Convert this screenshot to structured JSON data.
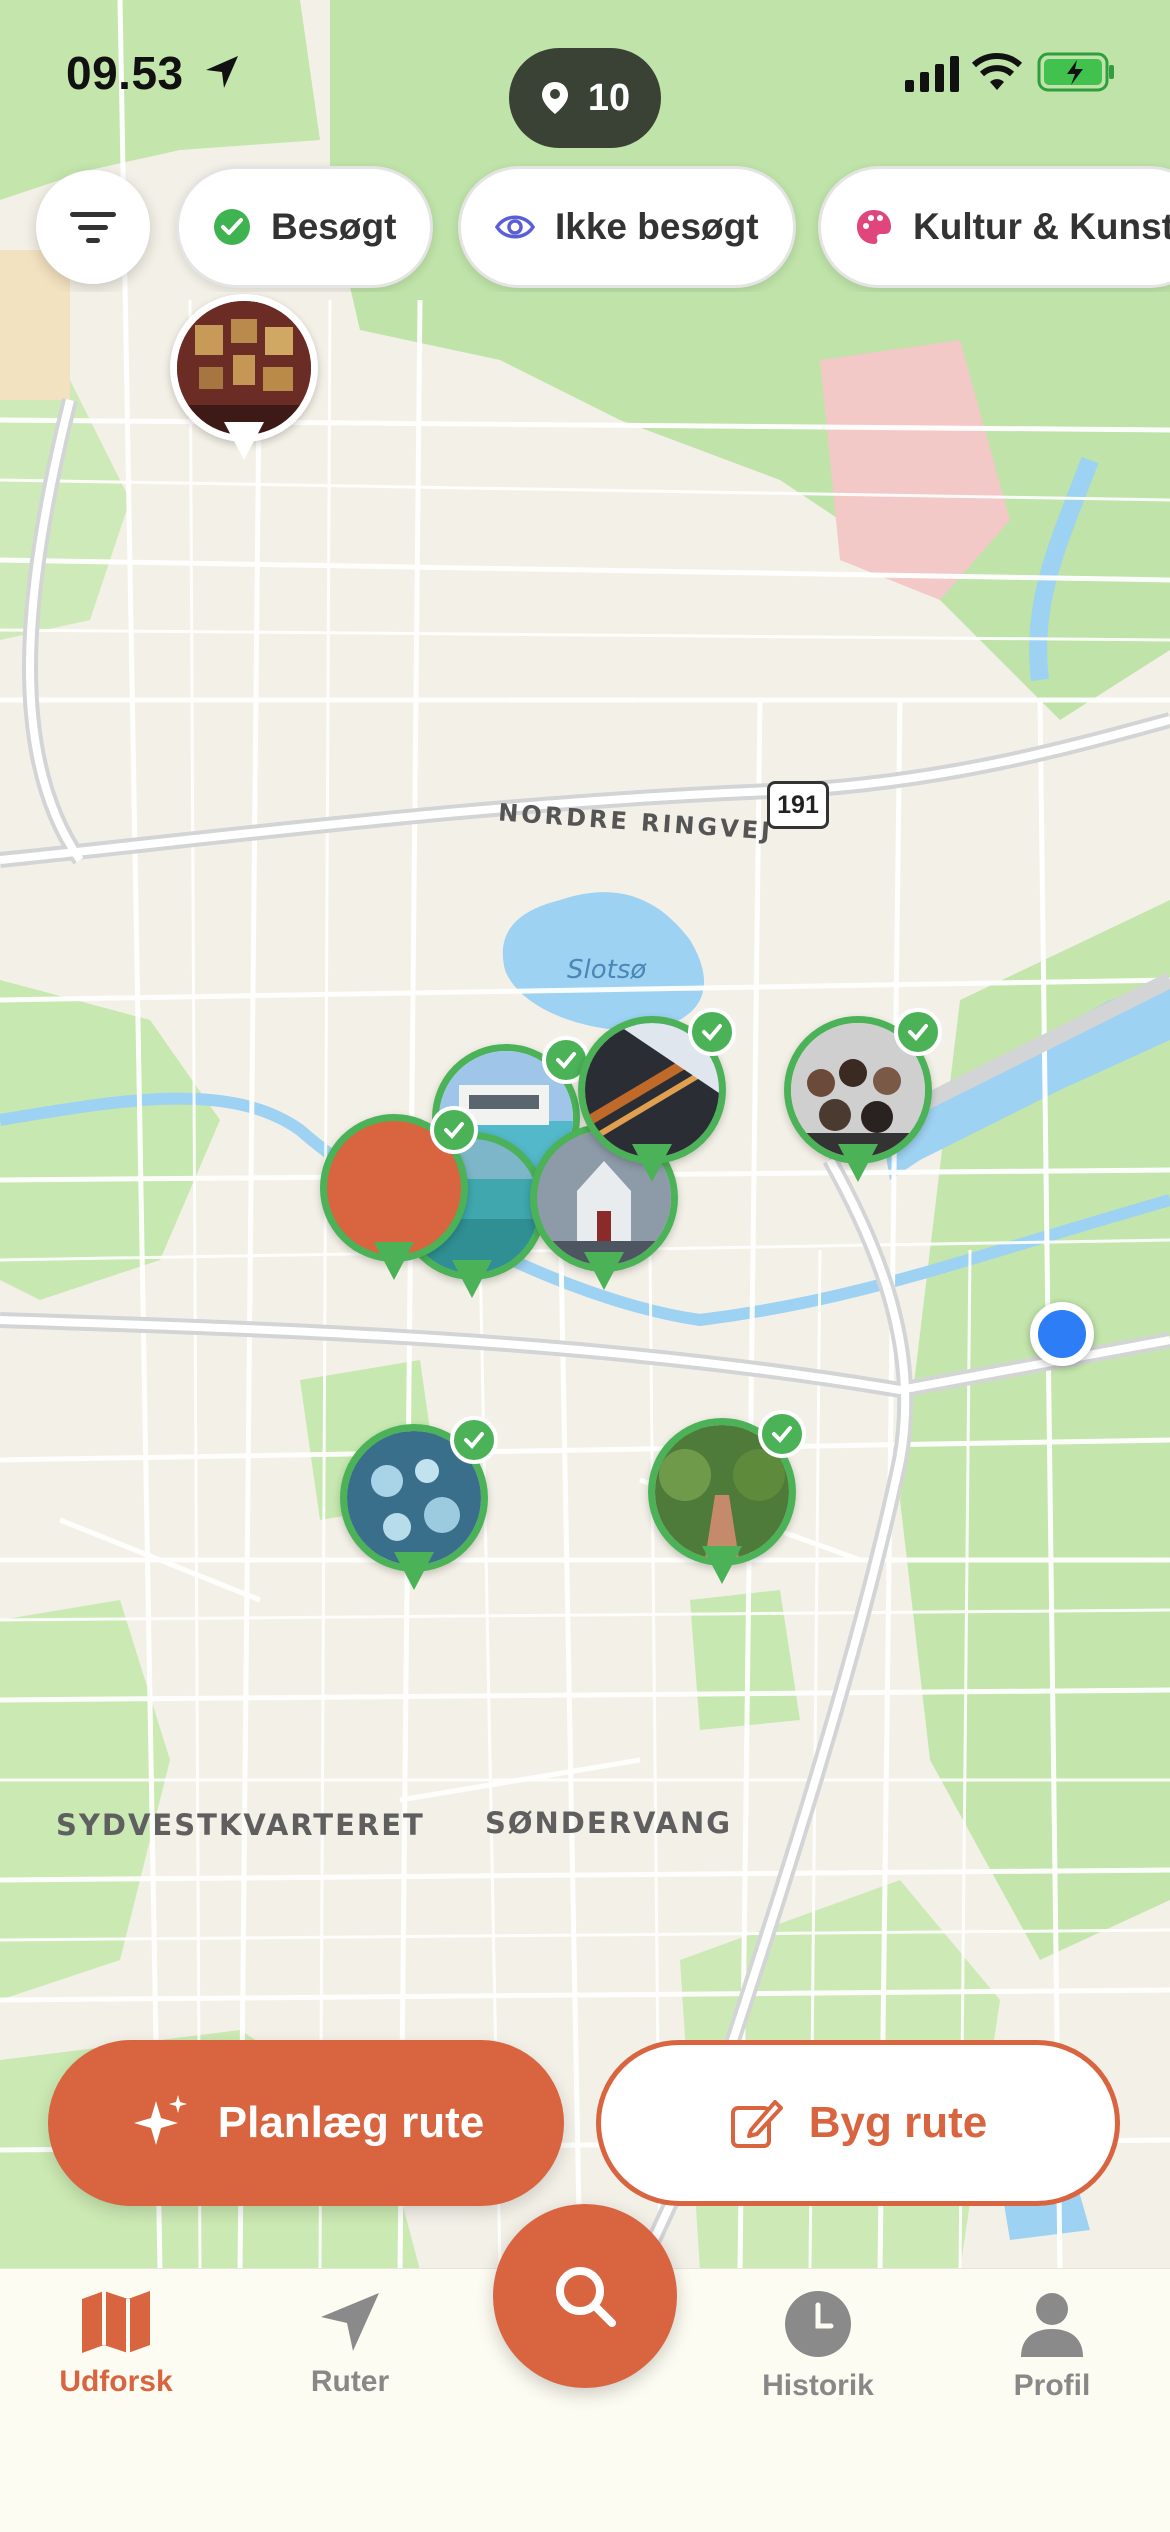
{
  "status_bar": {
    "time": "09.53"
  },
  "places_count": "10",
  "filters": {
    "chips": [
      {
        "label": "Besøgt",
        "icon": "check-circle-icon"
      },
      {
        "label": "Ikke besøgt",
        "icon": "eye-icon"
      },
      {
        "label": "Kultur & Kunst",
        "icon": "palette-icon"
      }
    ]
  },
  "map": {
    "road_label": "NORDRE RINGVEJ",
    "route_number": "191",
    "lake_label": "Slotsø",
    "area_labels": [
      "SYDVESTKVARTERET",
      "SØNDERVANG"
    ]
  },
  "actions": {
    "plan_route": "Planlæg rute",
    "build_route": "Byg rute"
  },
  "tabs": [
    {
      "label": "Udforsk",
      "icon": "map-icon",
      "active": true
    },
    {
      "label": "Ruter",
      "icon": "navigation-icon",
      "active": false
    },
    {
      "label": "Historik",
      "icon": "clock-icon",
      "active": false
    },
    {
      "label": "Profil",
      "icon": "person-icon",
      "active": false
    }
  ],
  "colors": {
    "accent": "#d8653f",
    "visited": "#4bb257",
    "user_location": "#2d7df6"
  }
}
